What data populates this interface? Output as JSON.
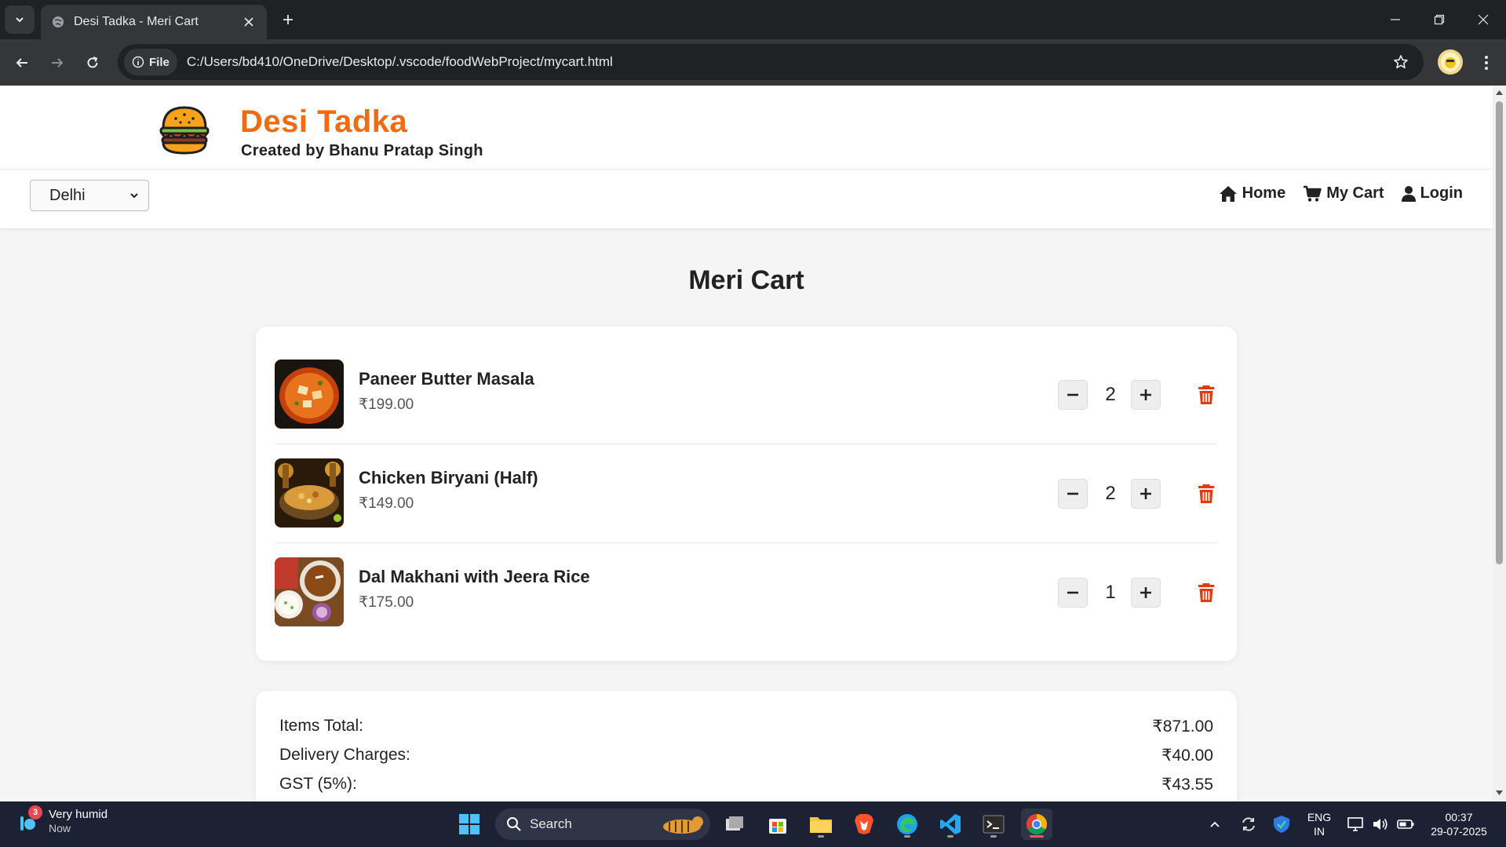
{
  "browser": {
    "tab_title": "Desi Tadka - Meri Cart",
    "file_chip": "File",
    "url": "C:/Users/bd410/OneDrive/Desktop/.vscode/foodWebProject/mycart.html"
  },
  "site": {
    "brand": "Desi Tadka",
    "tagline": "Created by Bhanu Pratap Singh",
    "city_selected": "Delhi",
    "nav": {
      "home": "Home",
      "cart": "My Cart",
      "login": "Login"
    }
  },
  "cart": {
    "title": "Meri Cart",
    "items": [
      {
        "name": "Paneer Butter Masala",
        "price": "₹199.00",
        "qty": "2",
        "thumb": "paneer-butter-masala"
      },
      {
        "name": "Chicken Biryani (Half)",
        "price": "₹149.00",
        "qty": "2",
        "thumb": "chicken-biryani"
      },
      {
        "name": "Dal Makhani with Jeera Rice",
        "price": "₹175.00",
        "qty": "1",
        "thumb": "dal-makhani"
      }
    ]
  },
  "summary": {
    "items_total_label": "Items Total:",
    "items_total": "₹871.00",
    "delivery_label": "Delivery Charges:",
    "delivery": "₹40.00",
    "gst_label": "GST (5%):",
    "gst": "₹43.55"
  },
  "taskbar": {
    "weather_title": "Very humid",
    "weather_sub": "Now",
    "weather_badge": "3",
    "search": "Search",
    "lang_top": "ENG",
    "lang_bottom": "IN",
    "time": "00:37",
    "date": "29-07-2025"
  },
  "colors": {
    "brand": "#f26b0f",
    "trash": "#e23b12",
    "page_bg": "#f5f5f5"
  }
}
